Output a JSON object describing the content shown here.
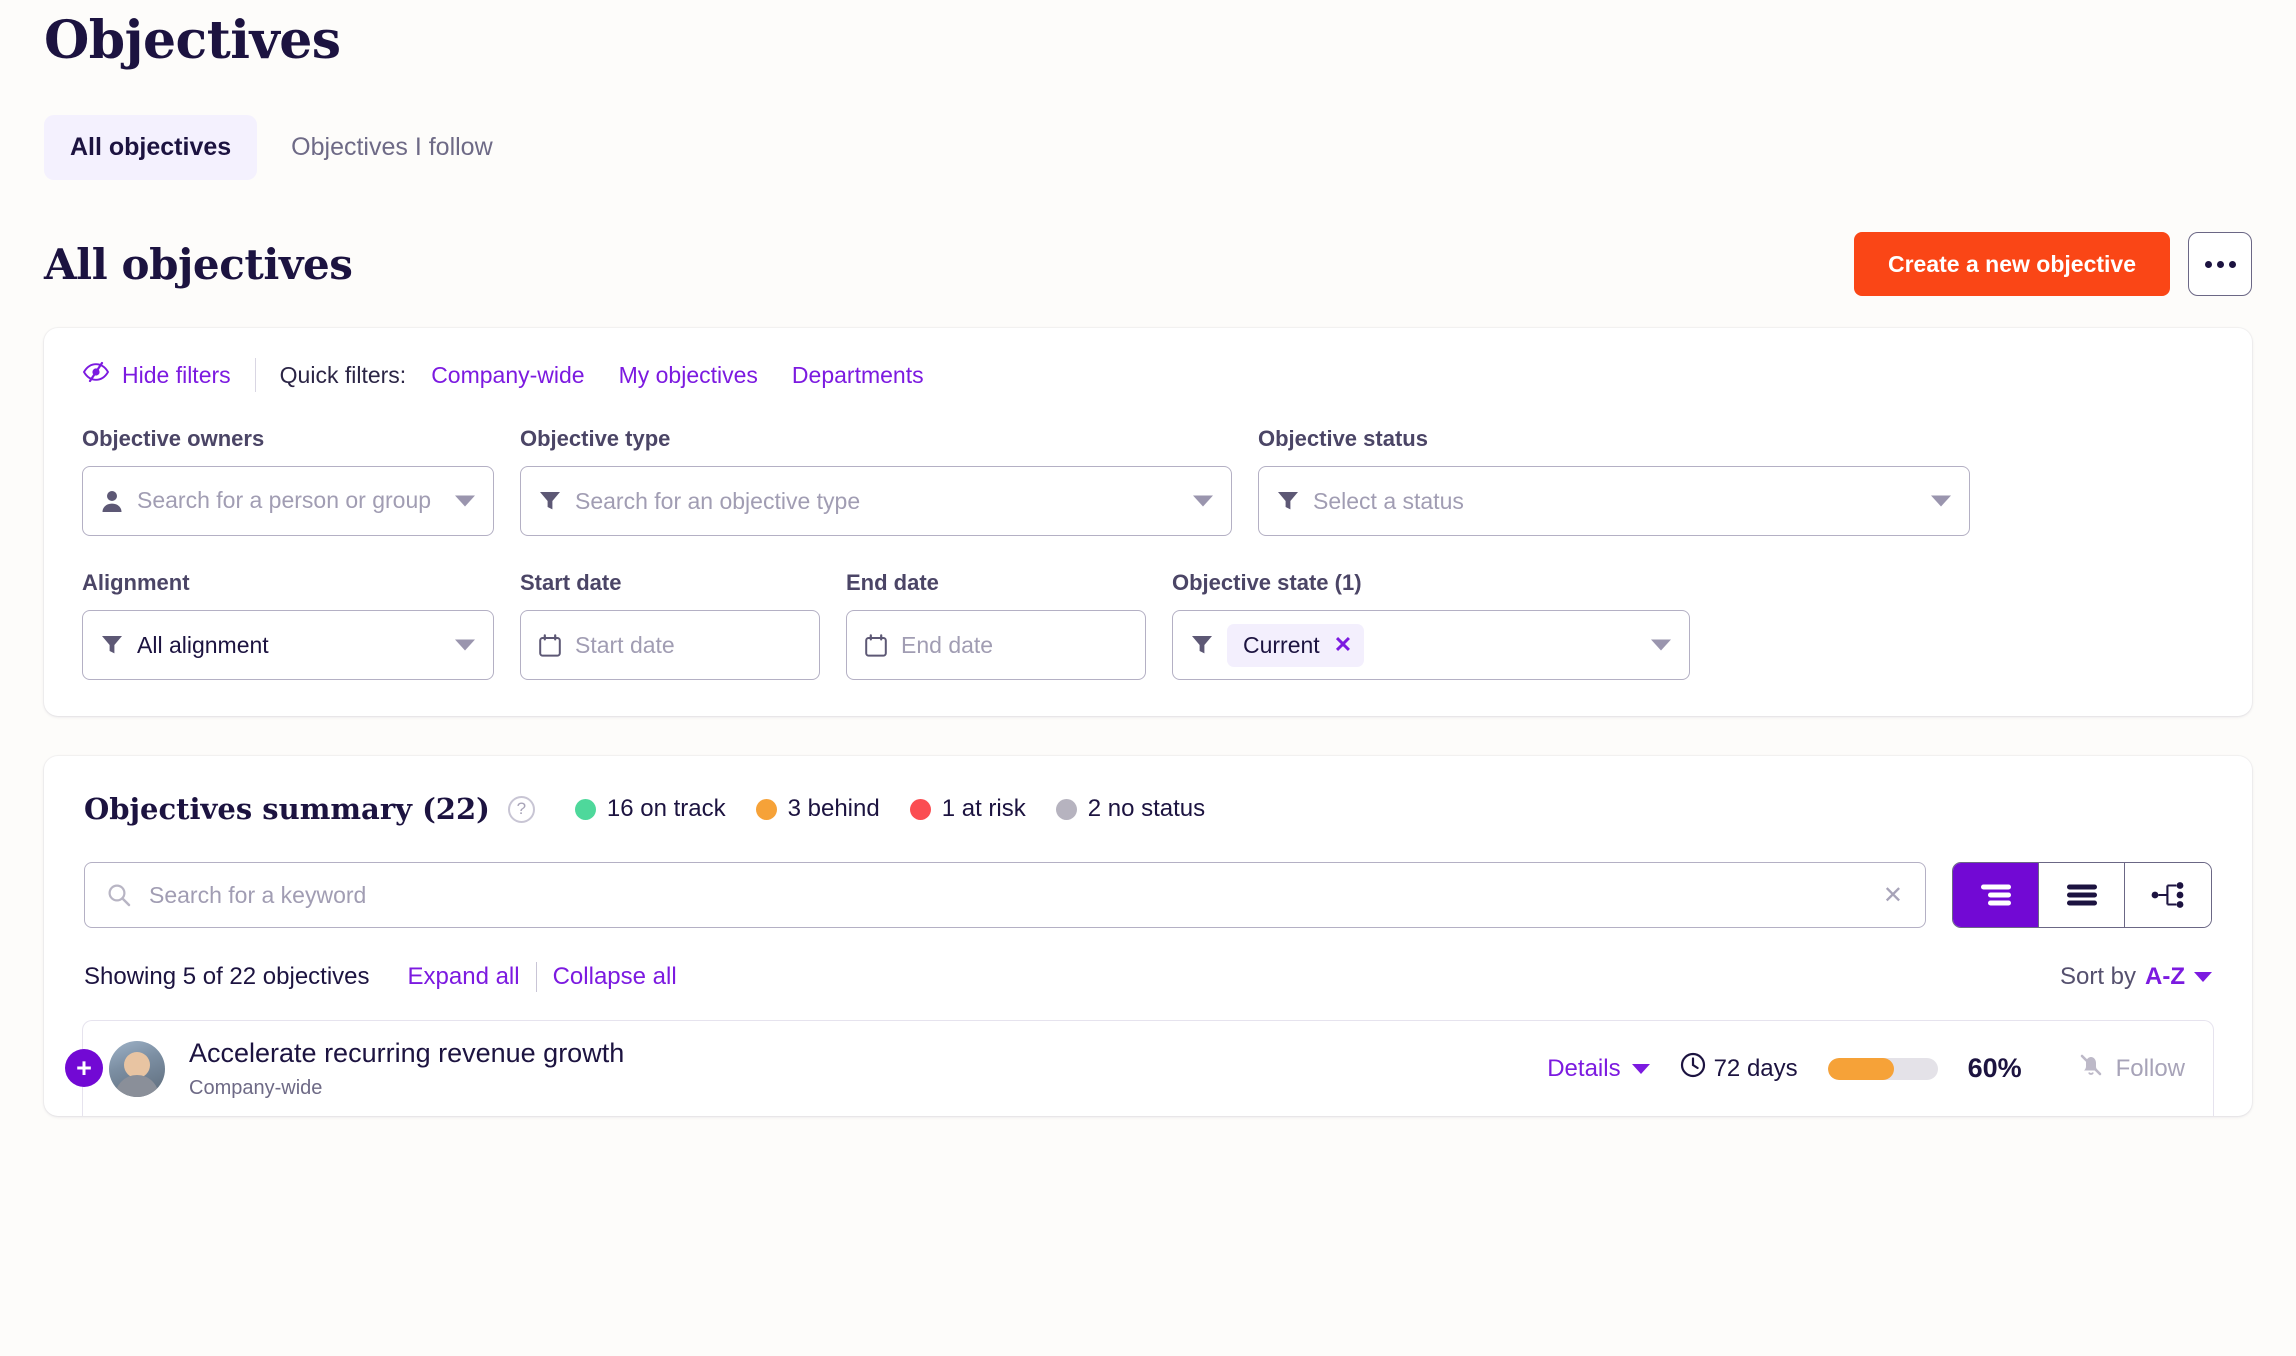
{
  "page": {
    "title": "Objectives"
  },
  "tabs": [
    {
      "label": "All objectives",
      "active": true
    },
    {
      "label": "Objectives I follow",
      "active": false
    }
  ],
  "section": {
    "title": "All objectives",
    "create_label": "Create a new objective",
    "more_label": "..."
  },
  "filters": {
    "hide_filters_label": "Hide filters",
    "quick_filters_label": "Quick filters:",
    "quick_links": [
      {
        "label": "Company-wide"
      },
      {
        "label": "My objectives"
      },
      {
        "label": "Departments"
      }
    ],
    "owners": {
      "label": "Objective owners",
      "placeholder": "Search for a person or group"
    },
    "type": {
      "label": "Objective type",
      "placeholder": "Search for an objective type"
    },
    "status": {
      "label": "Objective status",
      "placeholder": "Select a status"
    },
    "alignment": {
      "label": "Alignment",
      "value": "All alignment"
    },
    "start_date": {
      "label": "Start date",
      "placeholder": "Start date"
    },
    "end_date": {
      "label": "End date",
      "placeholder": "End date"
    },
    "state": {
      "label": "Objective state (1)",
      "chip": "Current",
      "chip_remove": "✕"
    }
  },
  "summary": {
    "title": "Objectives summary (22)",
    "help": "?",
    "legend": [
      {
        "label": "16 on track",
        "color": "#4ed89b"
      },
      {
        "label": "3 behind",
        "color": "#f6a238"
      },
      {
        "label": "1 at risk",
        "color": "#fb4d52"
      },
      {
        "label": "2 no status",
        "color": "#b6b3bf"
      }
    ]
  },
  "search": {
    "placeholder": "Search for a keyword",
    "value": "",
    "clear": "✕"
  },
  "views": [
    {
      "name": "compact-list-view",
      "active": true
    },
    {
      "name": "list-view",
      "active": false
    },
    {
      "name": "tree-view",
      "active": false
    }
  ],
  "listing": {
    "showing": "Showing 5 of 22 objectives",
    "expand_all": "Expand all",
    "collapse_all": "Collapse all",
    "sort_label": "Sort by",
    "sort_value": "A-Z"
  },
  "objectives": [
    {
      "title": "Accelerate recurring revenue growth",
      "subtitle": "Company-wide",
      "details_label": "Details",
      "days": "72 days",
      "progress": 60,
      "progress_label": "60%",
      "follow_label": "Follow"
    }
  ],
  "colors": {
    "brand_purple": "#7c1ae0",
    "accent_orange": "#fa4616",
    "ink": "#1c1340",
    "progress": "#f6a238"
  }
}
